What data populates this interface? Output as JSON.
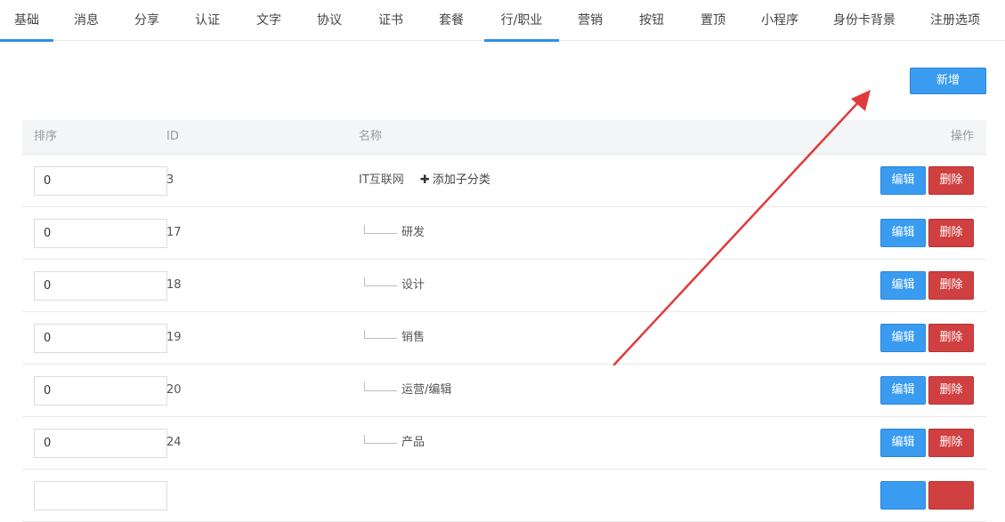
{
  "tabs": [
    {
      "label": "基础",
      "active": true
    },
    {
      "label": "消息",
      "active": false
    },
    {
      "label": "分享",
      "active": false
    },
    {
      "label": "认证",
      "active": false
    },
    {
      "label": "文字",
      "active": false
    },
    {
      "label": "协议",
      "active": false
    },
    {
      "label": "证书",
      "active": false
    },
    {
      "label": "套餐",
      "active": false
    },
    {
      "label": "行/职业",
      "active": true
    },
    {
      "label": "营销",
      "active": false
    },
    {
      "label": "按钮",
      "active": false
    },
    {
      "label": "置顶",
      "active": false
    },
    {
      "label": "小程序",
      "active": false
    },
    {
      "label": "身份卡背景",
      "active": false
    },
    {
      "label": "注册选项",
      "active": false
    }
  ],
  "toolbar": {
    "add_label": "新增"
  },
  "table": {
    "headers": {
      "sort": "排序",
      "id": "ID",
      "name": "名称",
      "ops": "操作"
    },
    "add_child_label": "添加子分类",
    "edit_label": "编辑",
    "delete_label": "删除",
    "rows": [
      {
        "sort": "0",
        "id": "3",
        "name": "IT互联网",
        "child": false
      },
      {
        "sort": "0",
        "id": "17",
        "name": "研发",
        "child": true
      },
      {
        "sort": "0",
        "id": "18",
        "name": "设计",
        "child": true
      },
      {
        "sort": "0",
        "id": "19",
        "name": "销售",
        "child": true
      },
      {
        "sort": "0",
        "id": "20",
        "name": "运营/编辑",
        "child": true
      },
      {
        "sort": "0",
        "id": "24",
        "name": "产品",
        "child": true
      }
    ]
  },
  "colors": {
    "accent": "#2d8fe6",
    "primary_button": "#3a9cf0",
    "danger_button": "#d04040",
    "annotation_arrow": "#e03a3a"
  }
}
